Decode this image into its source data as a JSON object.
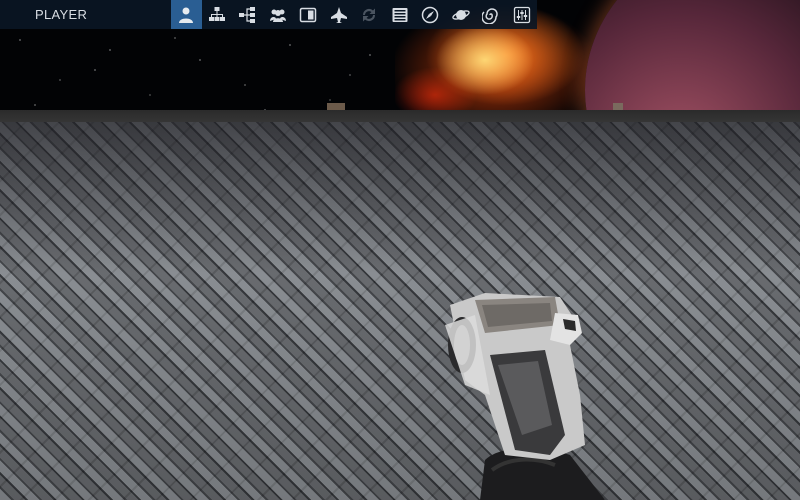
{
  "hud": {
    "title": "PLAYER",
    "active_tab": 0,
    "icons": [
      {
        "name": "player-icon",
        "state": "active"
      },
      {
        "name": "faction-icon",
        "state": "normal"
      },
      {
        "name": "network-icon",
        "state": "normal"
      },
      {
        "name": "group-icon",
        "state": "normal"
      },
      {
        "name": "inventory-icon",
        "state": "normal"
      },
      {
        "name": "ship-icon",
        "state": "normal"
      },
      {
        "name": "refresh-icon",
        "state": "disabled"
      },
      {
        "name": "list-icon",
        "state": "normal"
      },
      {
        "name": "compass-icon",
        "state": "normal"
      },
      {
        "name": "planet-icon",
        "state": "normal"
      },
      {
        "name": "galaxy-icon",
        "state": "normal"
      },
      {
        "name": "settings-sliders-icon",
        "state": "normal"
      }
    ]
  },
  "colors": {
    "hud_background": "#0a1624",
    "hud_active": "#2a5e93",
    "hud_text": "#d8dde3"
  }
}
